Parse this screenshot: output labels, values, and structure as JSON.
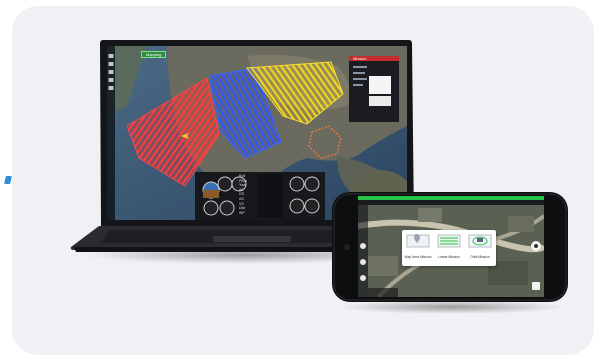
{
  "gcs_app": {
    "status_chip": "Mapping",
    "telemetry_labels": [
      "Roll",
      "Pitch",
      "Yaw",
      "Alt",
      "GS",
      "AS",
      "VS",
      "Dist",
      "WP"
    ],
    "panel_title": "Mission"
  },
  "mobile_app": {
    "options": [
      {
        "label": "Map Area Mission",
        "icon": "map-area-icon"
      },
      {
        "label": "Linear Mission",
        "icon": "linear-mission-icon"
      },
      {
        "label": "Orbit Mission",
        "icon": "orbit-mission-icon"
      }
    ]
  },
  "colors": {
    "accent": "#2e8fd6",
    "survey_red": "#e83a3a",
    "survey_blue": "#2a4fe8",
    "survey_yellow": "#f0d020",
    "status_green": "#25c24a"
  }
}
